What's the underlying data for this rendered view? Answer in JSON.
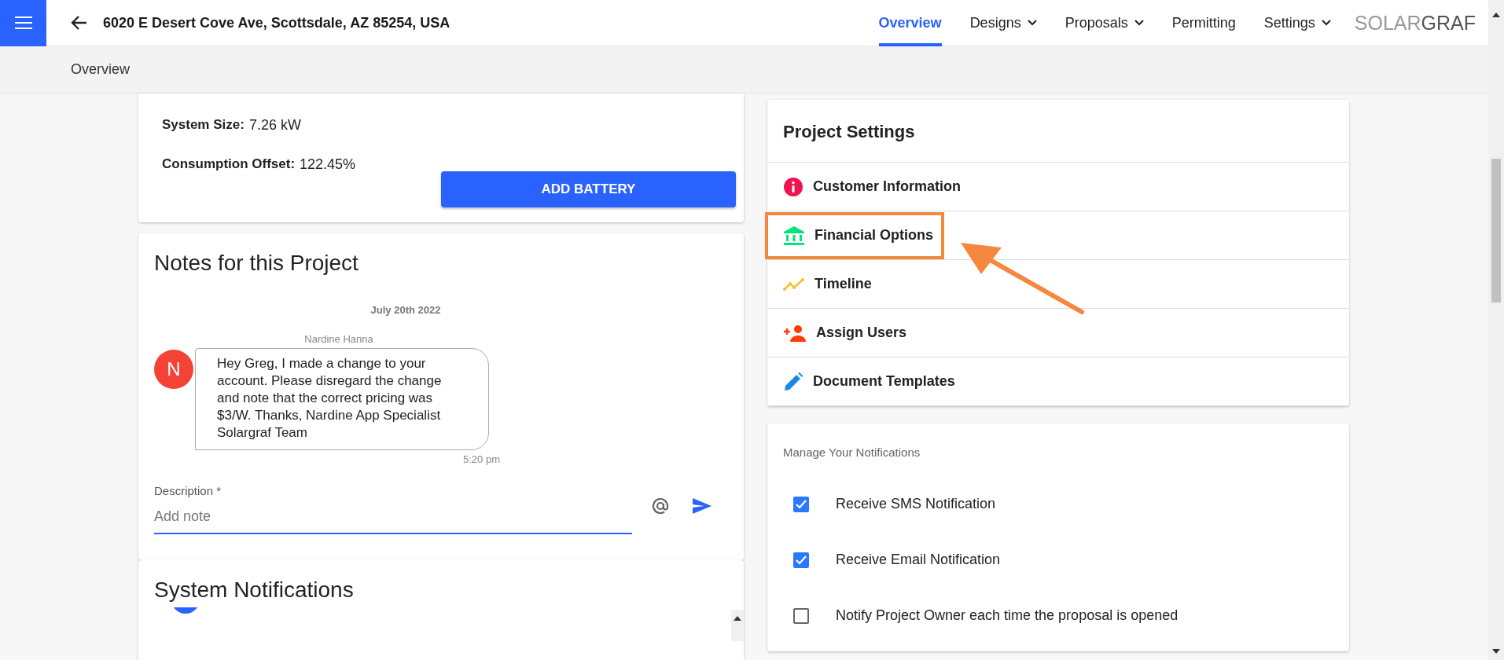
{
  "header": {
    "address": "6020 E Desert Cove Ave, Scottsdale, AZ 85254, USA",
    "nav": [
      {
        "label": "Overview",
        "selected": true,
        "dropdown": false
      },
      {
        "label": "Designs",
        "selected": false,
        "dropdown": true
      },
      {
        "label": "Proposals",
        "selected": false,
        "dropdown": true
      },
      {
        "label": "Permitting",
        "selected": false,
        "dropdown": false
      },
      {
        "label": "Settings",
        "selected": false,
        "dropdown": true
      }
    ],
    "logo": "SOLAR**GRAF**"
  },
  "breadcrumb": "Overview",
  "system": {
    "stats": [
      {
        "label": "System Size:",
        "value": "7.26 kW"
      },
      {
        "label": "Consumption Offset:",
        "value": "122.45%"
      }
    ],
    "button": "ADD BATTERY"
  },
  "notes": {
    "title": "Notes for this Project",
    "date": "July 20th 2022",
    "messages": [
      {
        "author": "Nardine Hanna",
        "initial": "N",
        "text": "Hey Greg, I made a change to your account. Please disregard the change and note that the correct pricing was $3/W. Thanks, Nardine App Specialist Solargraf Team",
        "time": "5:20 pm"
      }
    ],
    "field": {
      "label": "Description *",
      "placeholder": "Add note"
    }
  },
  "system_notifications": {
    "title": "System Notifications"
  },
  "project_settings": {
    "title": "Project Settings",
    "items": [
      {
        "kind": "info",
        "label": "Customer Information",
        "highlighted": false
      },
      {
        "kind": "bank",
        "label": "Financial Options",
        "highlighted": true
      },
      {
        "kind": "timeline",
        "label": "Timeline",
        "highlighted": false
      },
      {
        "kind": "users",
        "label": "Assign Users",
        "highlighted": false
      },
      {
        "kind": "pencil",
        "label": "Document Templates",
        "highlighted": false
      }
    ]
  },
  "notifications": {
    "title": "Manage Your Notifications",
    "options": [
      {
        "label": "Receive SMS Notification",
        "checked": true
      },
      {
        "label": "Receive Email Notification",
        "checked": true
      },
      {
        "label": "Notify Project Owner each time the proposal is opened",
        "checked": false
      }
    ]
  }
}
